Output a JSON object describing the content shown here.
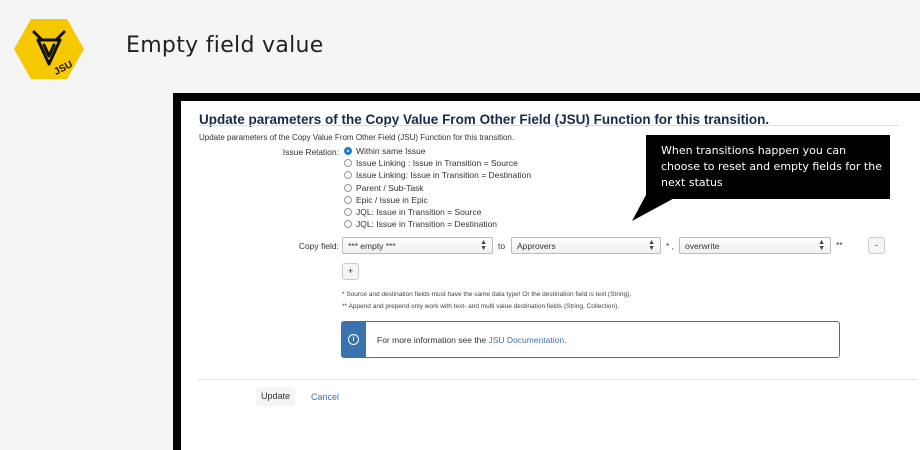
{
  "slide": {
    "title": "Empty field value",
    "logo_text": "JSU",
    "logo_color": "#f5c800"
  },
  "dialog": {
    "title": "Update parameters of the Copy Value From Other Field (JSU) Function for this transition.",
    "description": "Update parameters of the Copy Value From Other Field (JSU) Function for this transition.",
    "issue_relation": {
      "label": "Issue Relation:",
      "selected_index": 0,
      "options": [
        "Within same Issue",
        "Issue Linking : Issue in Transition = Source",
        "Issue Linking: Issue in Transition = Destination",
        "Parent / Sub-Task",
        "Epic / Issue in Epic",
        "JQL: Issue in Transition = Source",
        "JQL: Issue in Transition = Destination"
      ]
    },
    "copy_field": {
      "label": "Copy field:",
      "source_value": "*** empty ***",
      "to_text": "to",
      "destination_value": "Approvers",
      "destination_suffix": "* ,",
      "mode_value": "overwrite",
      "mode_suffix": "**",
      "remove_label": "-",
      "add_label": "+"
    },
    "notes": [
      "* Source and destination fields must have the same data type! Or the destination field is text (String).",
      "** Append and prepend only work with text- and multi value destination fields (String, Collection)."
    ],
    "info": {
      "icon": "info-icon",
      "text_before": "For more information see the ",
      "link_text": "JSU Documentation",
      "text_after": "."
    },
    "footer": {
      "update_label": "Update",
      "cancel_label": "Cancel"
    }
  },
  "callout": {
    "text": "When transitions happen you can choose to reset and empty fields for the next status"
  },
  "colors": {
    "accent": "#3b73af",
    "radio_selected": "#1d7bd8"
  }
}
